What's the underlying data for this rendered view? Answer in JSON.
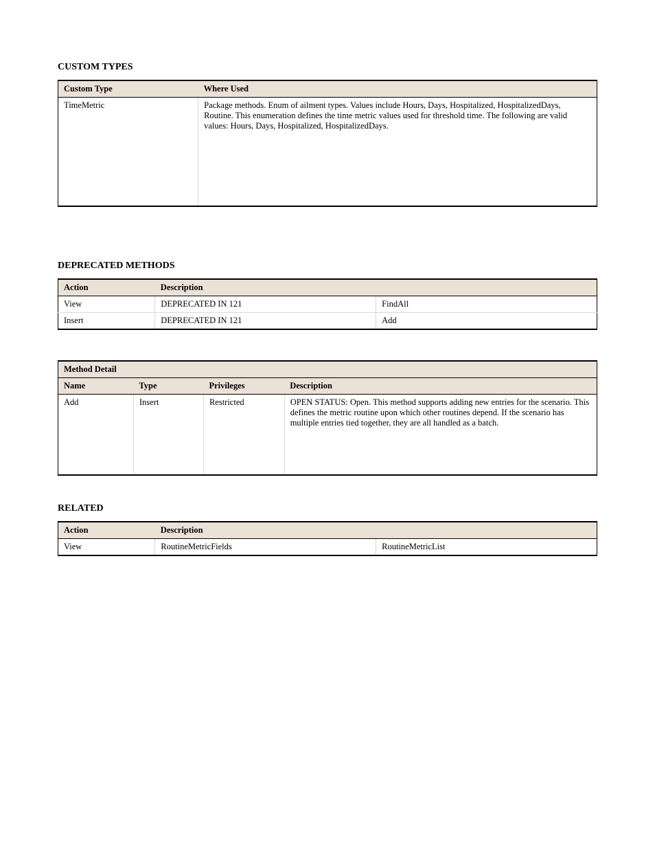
{
  "section_custom_types": {
    "title": "CUSTOM TYPES",
    "table": {
      "headers": [
        "Custom Type",
        "Where Used"
      ],
      "rows": [
        {
          "type": "TimeMetric",
          "used": "Package methods. Enum of ailment types. Values include Hours, Days, Hospitalized, HospitalizedDays, Routine. This enumeration defines the time metric values used for threshold time. The following are valid values: Hours, Days, Hospitalized, HospitalizedDays."
        }
      ]
    }
  },
  "section_deprecated": {
    "title": "DEPRECATED METHODS",
    "table": {
      "headers": [
        "Action",
        "Description"
      ],
      "rows": [
        {
          "action": "View",
          "old": "DEPRECATED IN 121",
          "new": "FindAll"
        },
        {
          "action": "Insert",
          "old": "DEPRECATED IN 121",
          "new": "Add"
        }
      ]
    }
  },
  "section_method_detail": {
    "band": "Method Detail",
    "headers": [
      "Name",
      "Type",
      "Privileges",
      "Description"
    ],
    "name": "Add",
    "type": "Insert",
    "priv": "Restricted",
    "desc": "OPEN STATUS: Open.\nThis method supports adding new entries for the scenario. This defines the metric routine upon which other routines depend. If the scenario has multiple entries tied together, they are all handled as a batch."
  },
  "section_related": {
    "title": "RELATED",
    "headers": [
      "Action",
      "Description"
    ],
    "rows": [
      {
        "action": "View",
        "item1": "RoutineMetricFields",
        "item2": "RoutineMetricList"
      }
    ]
  }
}
